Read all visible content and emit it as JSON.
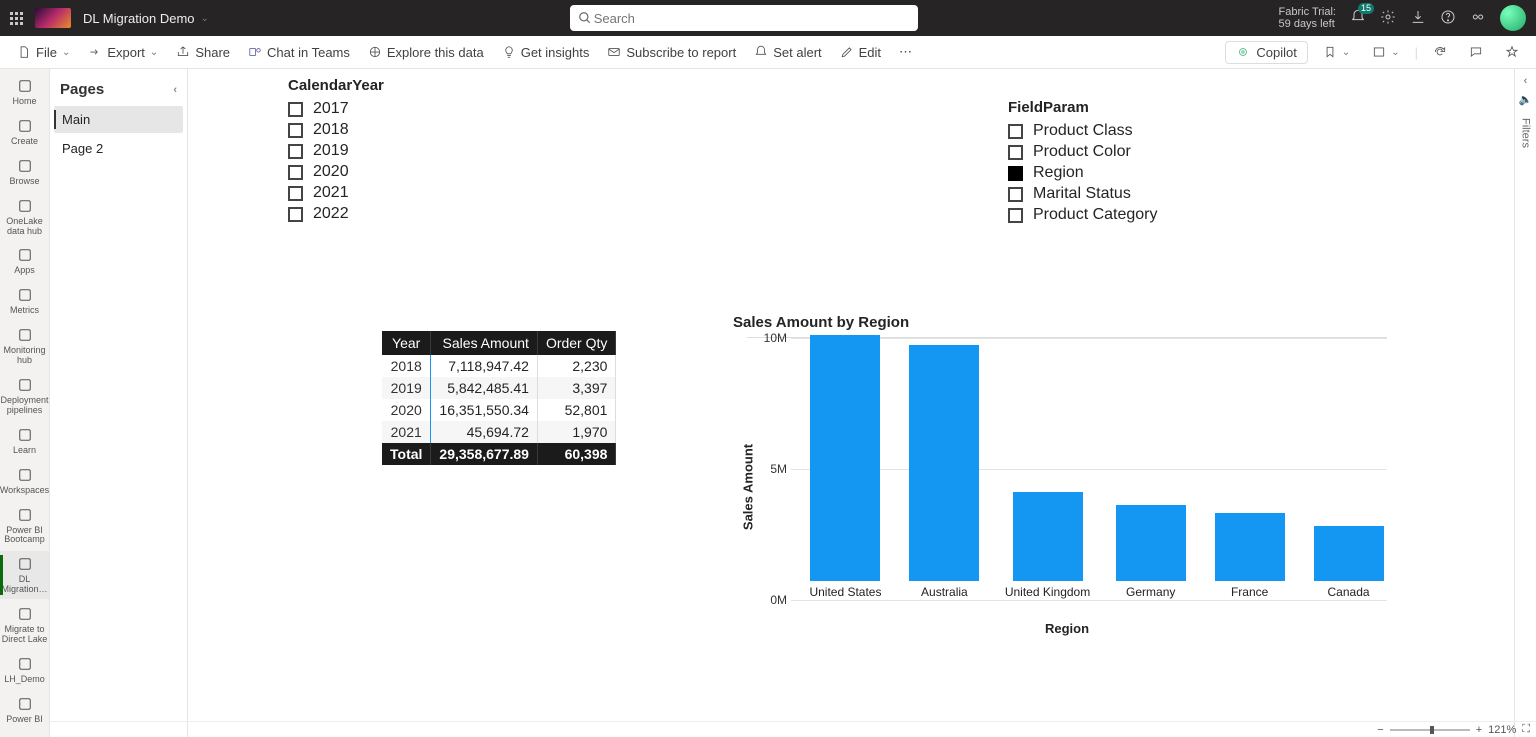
{
  "top": {
    "workspace_name": "DL Migration Demo",
    "search_placeholder": "Search",
    "trial_line1": "Fabric Trial:",
    "trial_line2": "59 days left",
    "notif_badge": "15"
  },
  "bar": {
    "file": "File",
    "export": "Export",
    "share": "Share",
    "chat": "Chat in Teams",
    "explore": "Explore this data",
    "insights": "Get insights",
    "subscribe": "Subscribe to report",
    "alert": "Set alert",
    "edit": "Edit",
    "copilot": "Copilot"
  },
  "leftnav": {
    "items": [
      "Home",
      "Create",
      "Browse",
      "OneLake data hub",
      "Apps",
      "Metrics",
      "Monitoring hub",
      "Deployment pipelines",
      "Learn",
      "Workspaces",
      "Power BI Bootcamp",
      "DL Migration…",
      "Migrate to Direct Lake",
      "LH_Demo",
      "Power BI"
    ],
    "active_index": 11
  },
  "pages": {
    "title": "Pages",
    "items": [
      "Main",
      "Page 2"
    ],
    "selected_index": 0
  },
  "slicer_year": {
    "title": "CalendarYear",
    "options": [
      "2017",
      "2018",
      "2019",
      "2020",
      "2021",
      "2022"
    ]
  },
  "slicer_field": {
    "title": "FieldParam",
    "options": [
      {
        "label": "Product Class",
        "checked": false
      },
      {
        "label": "Product Color",
        "checked": false
      },
      {
        "label": "Region",
        "checked": true
      },
      {
        "label": "Marital Status",
        "checked": false
      },
      {
        "label": "Product Category",
        "checked": false
      }
    ]
  },
  "table": {
    "headers": [
      "Year",
      "Sales Amount",
      "Order Qty"
    ],
    "rows": [
      [
        "2018",
        "7,118,947.42",
        "2,230"
      ],
      [
        "2019",
        "5,842,485.41",
        "3,397"
      ],
      [
        "2020",
        "16,351,550.34",
        "52,801"
      ],
      [
        "2021",
        "45,694.72",
        "1,970"
      ]
    ],
    "total": [
      "Total",
      "29,358,677.89",
      "60,398"
    ]
  },
  "chart_data": {
    "type": "bar",
    "title": "Sales Amount by Region",
    "xlabel": "Region",
    "ylabel": "Sales Amount",
    "ylim": [
      0,
      10000000
    ],
    "yticks": [
      {
        "v": 0,
        "lbl": "0M"
      },
      {
        "v": 5000000,
        "lbl": "5M"
      },
      {
        "v": 10000000,
        "lbl": "10M"
      }
    ],
    "categories": [
      "United States",
      "Australia",
      "United Kingdom",
      "Germany",
      "France",
      "Canada"
    ],
    "values": [
      9400000,
      9000000,
      3400000,
      2900000,
      2600000,
      2100000
    ]
  },
  "filters": {
    "label": "Filters"
  },
  "zoom": {
    "pct": "121%"
  }
}
